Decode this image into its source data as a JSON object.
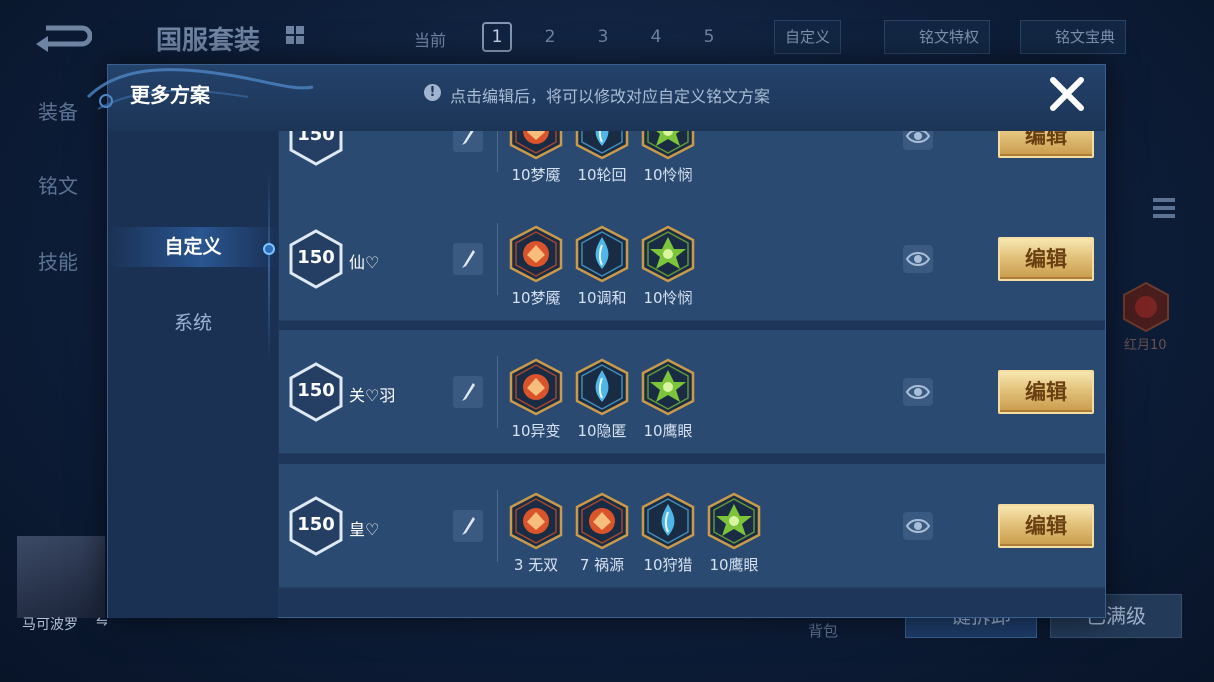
{
  "background": {
    "title": "国服套装",
    "current_label": "当前",
    "pages": [
      "1",
      "2",
      "3",
      "4",
      "5"
    ],
    "active_page": "1",
    "custom_label": "自定义",
    "rune_privilege": "铭文特权",
    "rune_codex": "铭文宝典",
    "side_tabs": [
      "装备",
      "铭文",
      "技能"
    ],
    "side_rune_label": "红月10",
    "hero_name": "马可波罗",
    "swap_icon": "⇋",
    "bag_label": "背包",
    "btn_select": "一键拆卸",
    "btn_max": "已满级"
  },
  "modal": {
    "title": "更多方案",
    "info_text": "点击编辑后，将可以修改对应自定义铭文方案",
    "info_icon": "!",
    "tabs": [
      {
        "label": "自定义",
        "active": true
      },
      {
        "label": "系统",
        "active": false
      }
    ],
    "edit_label": "编辑",
    "plans": [
      {
        "level": "150",
        "name": "",
        "runes": [
          {
            "label": "10梦魇",
            "icon": "nightmare-red"
          },
          {
            "label": "10轮回",
            "icon": "reincarnation-blue"
          },
          {
            "label": "10怜悯",
            "icon": "mercy-green"
          }
        ]
      },
      {
        "level": "150",
        "name": "仙♡",
        "runes": [
          {
            "label": "10梦魇",
            "icon": "nightmare-red"
          },
          {
            "label": "10调和",
            "icon": "harmony-blue"
          },
          {
            "label": "10怜悯",
            "icon": "mercy-green"
          }
        ]
      },
      {
        "level": "150",
        "name": "关♡羽",
        "runes": [
          {
            "label": "10异变",
            "icon": "mutation-red"
          },
          {
            "label": "10隐匿",
            "icon": "stealth-blue"
          },
          {
            "label": "10鹰眼",
            "icon": "hawkeye-green"
          }
        ]
      },
      {
        "level": "150",
        "name": "皇♡",
        "runes": [
          {
            "label": "3 无双",
            "icon": "peerless-red"
          },
          {
            "label": "7 祸源",
            "icon": "calamity-red"
          },
          {
            "label": "10狩猎",
            "icon": "hunt-blue"
          },
          {
            "label": "10鹰眼",
            "icon": "hawkeye-green"
          }
        ]
      }
    ]
  },
  "colors": {
    "rune_red": "#d9542a",
    "rune_blue": "#4fb6e8",
    "rune_green": "#7cc43a",
    "rune_frame": "#c89a4c",
    "edit_gold": "#e2c27a"
  }
}
